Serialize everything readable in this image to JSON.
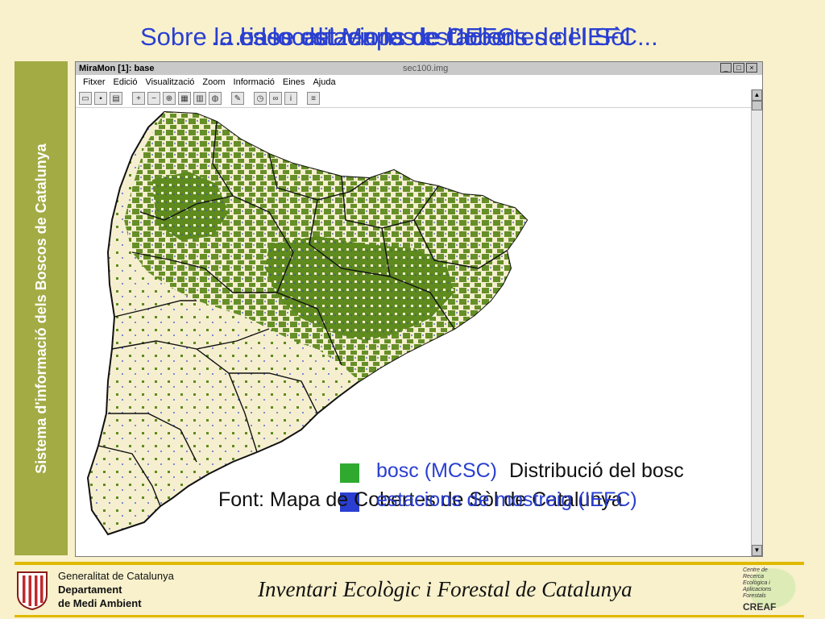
{
  "slide": {
    "title_layers": [
      "Sobre la base del Mapa de Cobertes del Sòl ...",
      "... es localitzen les estacions de l’IEFC",
      "... i les estacions de l’IEFC"
    ],
    "sidebar_label": "Sistema d'informació dels Boscos de Catalunya",
    "footer_title": "Inventari Ecològic i Forestal de Catalunya"
  },
  "window": {
    "app_title": "MiraMon [1]: base",
    "doc_title": "sec100.img",
    "controls": [
      "_",
      "□",
      "×"
    ],
    "menu": [
      "Fitxer",
      "Edició",
      "Visualització",
      "Zoom",
      "Informació",
      "Eines",
      "Ajuda"
    ],
    "toolbar_icons": [
      "open-icon",
      "save-icon",
      "print-icon",
      "zoom-in-icon",
      "zoom-out-icon",
      "zoom-all-icon",
      "view-icon",
      "layers-icon",
      "globe-icon",
      "pencil-icon",
      "clock-icon",
      "binoculars-icon",
      "info-icon",
      "stack-icon"
    ],
    "scroll_up": "▲",
    "scroll_down": "▼"
  },
  "legend": {
    "heading_1": "Distribució del bosc",
    "source_1": "Font: Mapa de Cobertes de Sòl de Catalunya",
    "item_bosc": "bosc (MCSC)",
    "item_estacions": "estacions de mostreig (IEFC)",
    "colors": {
      "bosc": "#2faa2f",
      "estacions": "#2a3fd1",
      "forest_map": "#5e8a1e",
      "land": "#f5efcf"
    }
  },
  "footer": {
    "gen_line1": "Generalitat de Catalunya",
    "gen_line2": "Departament",
    "gen_line3": "de Medi Ambient",
    "creaf_lines": [
      "Centre de",
      "Recerca",
      "Ecològica i",
      "Aplicacions",
      "Forestals"
    ],
    "creaf_brand": "CREAF"
  }
}
